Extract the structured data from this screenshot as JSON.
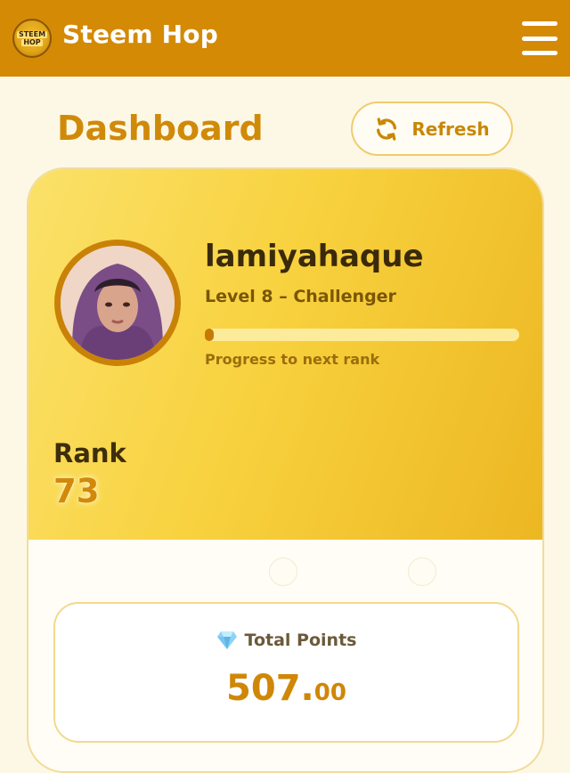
{
  "app": {
    "title": "Steem Hop",
    "logo_top": "STEEM",
    "logo_bottom": "HOP"
  },
  "page": {
    "title": "Dashboard",
    "refresh_label": "Refresh"
  },
  "profile": {
    "username": "lamiyahaque",
    "level_text": "Level 8 – Challenger",
    "progress_caption": "Progress to next rank",
    "progress_fraction": 0.02
  },
  "rank": {
    "label": "Rank",
    "value": "73"
  },
  "points": {
    "label": "Total Points",
    "value_int": "507.",
    "value_dec": "00"
  },
  "icons": {
    "menu": "hamburger-menu-icon",
    "refresh": "refresh-icon",
    "points": "diamond-icon"
  },
  "colors": {
    "header": "#d48a05",
    "accent": "#d08a09",
    "hero_start": "#fbe16a",
    "hero_end": "#ecb722",
    "background": "#fdf8e6"
  }
}
